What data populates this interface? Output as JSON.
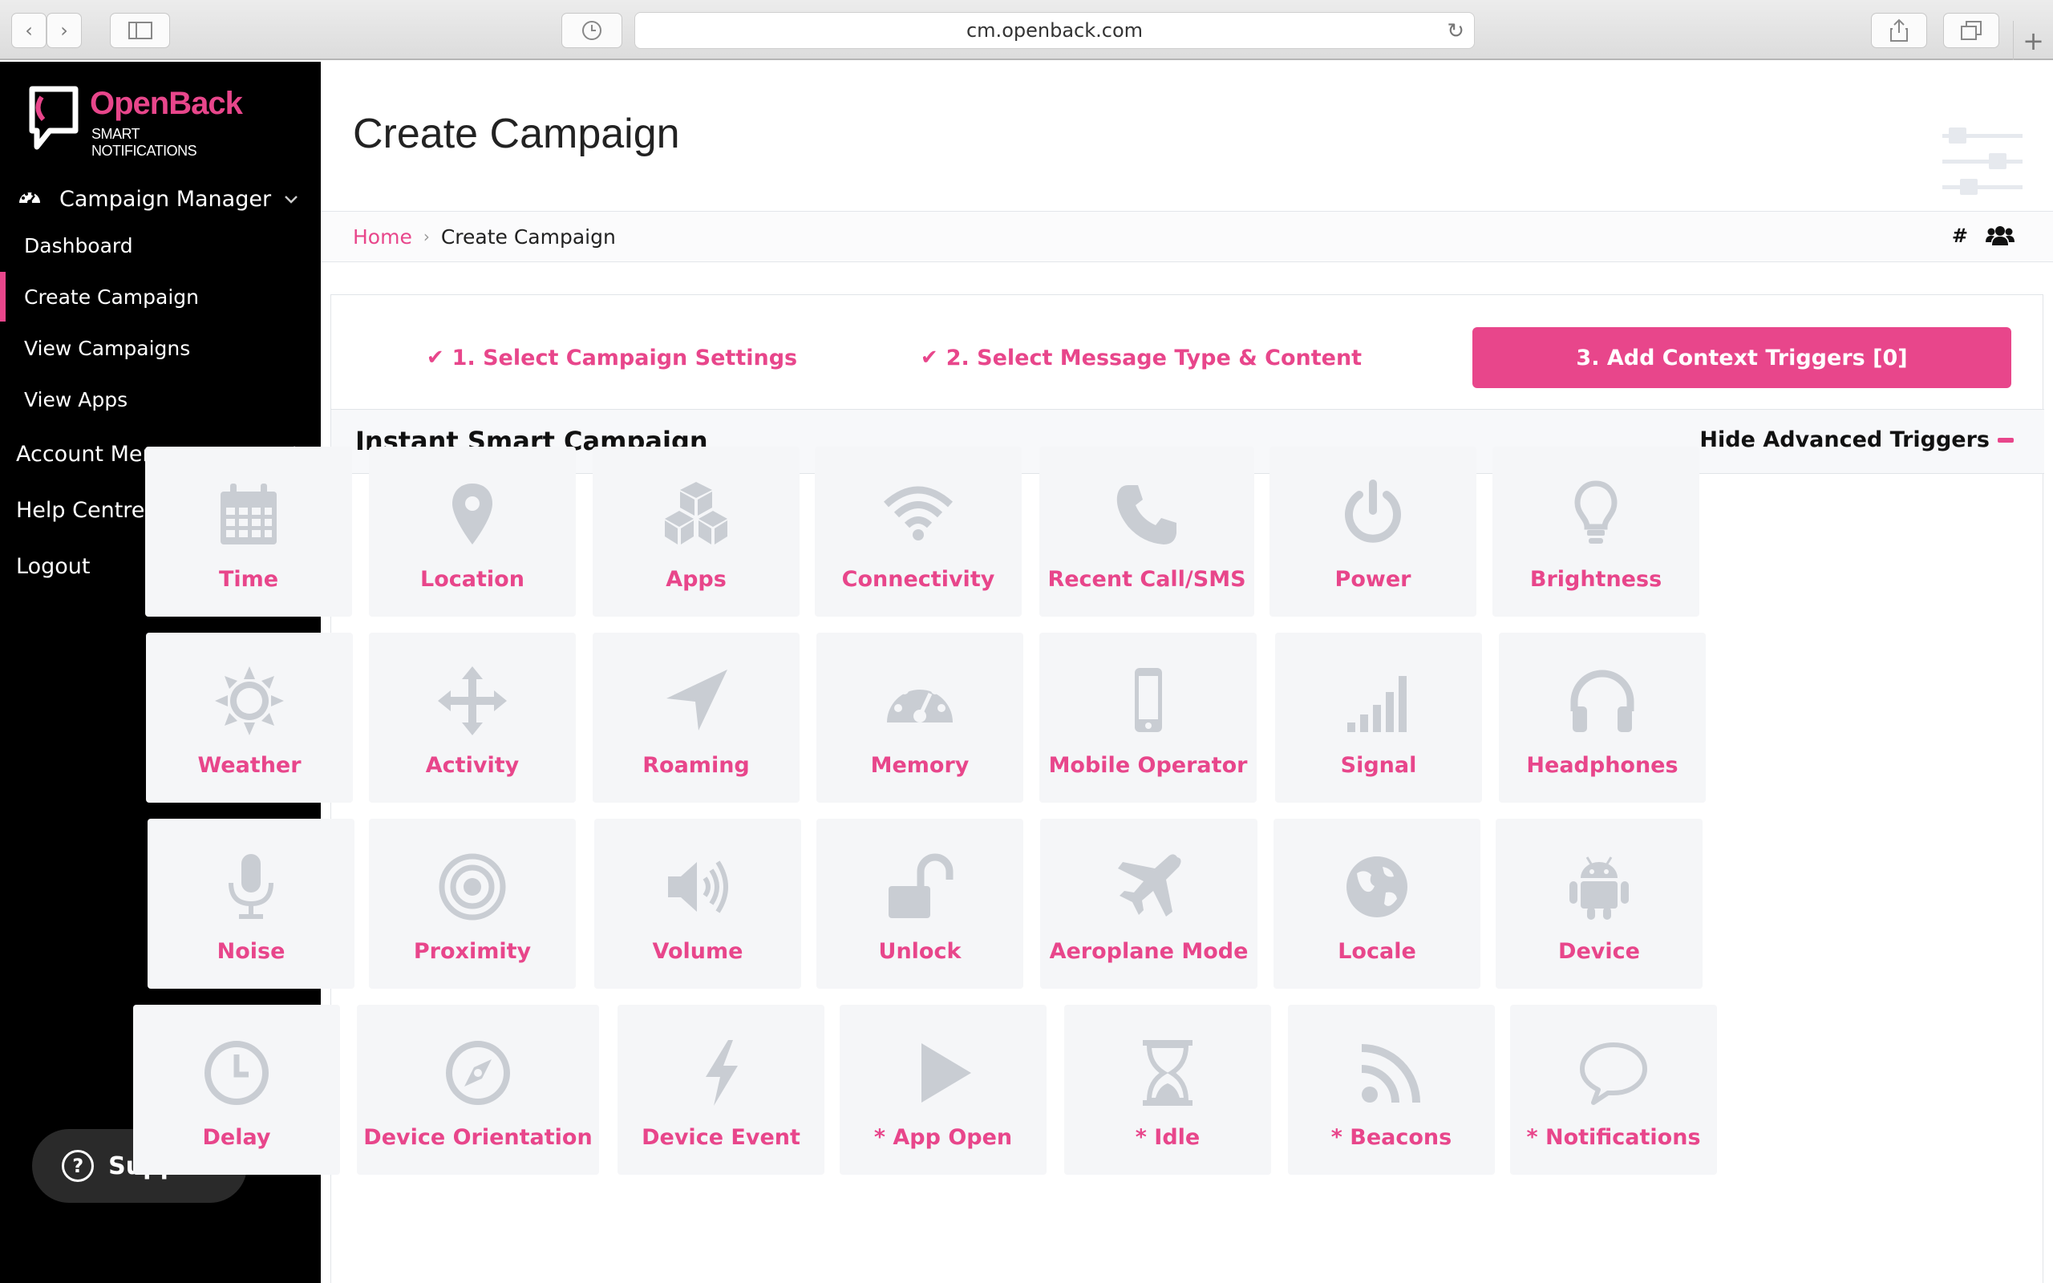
{
  "browser": {
    "url": "cm.openback.com"
  },
  "sidebar": {
    "logo_text": "OpenBack",
    "logo_sub": "SMART NOTIFICATIONS",
    "campaign_manager": "Campaign Manager",
    "items": [
      {
        "label": "Dashboard"
      },
      {
        "label": "Create Campaign"
      },
      {
        "label": "View Campaigns"
      },
      {
        "label": "View Apps"
      }
    ],
    "account_menu": "Account Menu",
    "help_centre": "Help Centre",
    "logout": "Logout",
    "support": "Support"
  },
  "header": {
    "title": "Create Campaign"
  },
  "breadcrumb": {
    "home": "Home",
    "separator": "›",
    "current": "Create Campaign",
    "hash": "#"
  },
  "steps": [
    {
      "label": "1. Select Campaign Settings",
      "done": true
    },
    {
      "label": "2. Select Message Type & Content",
      "done": true
    },
    {
      "label": "3. Add Context Triggers [0]",
      "active": true
    }
  ],
  "section": {
    "title": "Instant Smart Campaign",
    "toggle": "Hide Advanced Triggers"
  },
  "triggers": [
    {
      "label": "Time",
      "icon": "calendar-icon"
    },
    {
      "label": "Location",
      "icon": "map-pin-icon"
    },
    {
      "label": "Apps",
      "icon": "cubes-icon"
    },
    {
      "label": "Connectivity",
      "icon": "wifi-icon"
    },
    {
      "label": "Recent Call/SMS",
      "icon": "phone-icon"
    },
    {
      "label": "Power",
      "icon": "power-icon"
    },
    {
      "label": "Brightness",
      "icon": "lightbulb-icon"
    },
    {
      "label": "Weather",
      "icon": "sun-icon"
    },
    {
      "label": "Activity",
      "icon": "move-arrows-icon"
    },
    {
      "label": "Roaming",
      "icon": "location-arrow-icon"
    },
    {
      "label": "Memory",
      "icon": "gauge-icon"
    },
    {
      "label": "Mobile Operator",
      "icon": "mobile-icon"
    },
    {
      "label": "Signal",
      "icon": "signal-bars-icon"
    },
    {
      "label": "Headphones",
      "icon": "headphones-icon"
    },
    {
      "label": "Noise",
      "icon": "microphone-icon"
    },
    {
      "label": "Proximity",
      "icon": "target-icon"
    },
    {
      "label": "Volume",
      "icon": "volume-icon"
    },
    {
      "label": "Unlock",
      "icon": "unlock-icon"
    },
    {
      "label": "Aeroplane Mode",
      "icon": "plane-icon"
    },
    {
      "label": "Locale",
      "icon": "globe-icon"
    },
    {
      "label": "Device",
      "icon": "android-icon"
    },
    {
      "label": "Delay",
      "icon": "clock-icon"
    },
    {
      "label": "Device Orientation",
      "icon": "compass-icon"
    },
    {
      "label": "Device Event",
      "icon": "bolt-icon"
    },
    {
      "label": "* App Open",
      "icon": "play-icon"
    },
    {
      "label": "* Idle",
      "icon": "hourglass-icon"
    },
    {
      "label": "* Beacons",
      "icon": "rss-icon"
    },
    {
      "label": "* Notifications",
      "icon": "speech-bubble-icon"
    }
  ],
  "colors": {
    "accent": "#e8468b",
    "icon_gray": "#c9cdd3",
    "tile_bg": "#f5f6f8"
  }
}
